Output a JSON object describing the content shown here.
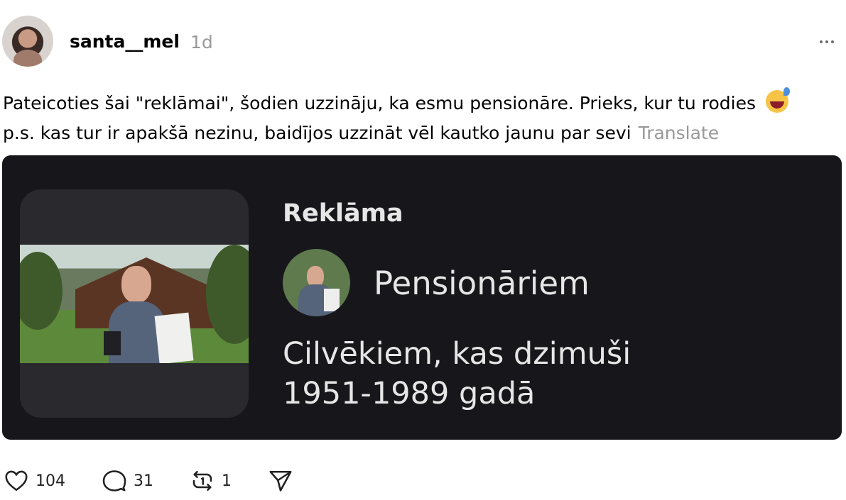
{
  "header": {
    "username": "santa__mel",
    "time_ago": "1d",
    "avatar_icon": "user-avatar",
    "more_icon": "more-horizontal-icon"
  },
  "post": {
    "line1": "Pateicoties šai \"reklāmai\", šodien uzzināju, ka esmu pensionāre. Prieks, kur tu rodies",
    "line2": "p.s. kas tur ir apakšā nezinu, baidījos uzzināt vēl kautko jaunu par sevi",
    "translate_label": "Translate",
    "emoji_icon": "grinning-sweat-emoji"
  },
  "ad": {
    "label": "Reklāma",
    "advertiser": "Pensionāriem",
    "description_line1": "Cilvēkiem, kas dzimuši",
    "description_line2": "1951-1989 gadā"
  },
  "actions": {
    "likes": "104",
    "comments": "31",
    "reposts": "1",
    "like_icon": "heart-icon",
    "comment_icon": "comment-icon",
    "repost_icon": "repost-icon",
    "share_icon": "send-icon"
  }
}
